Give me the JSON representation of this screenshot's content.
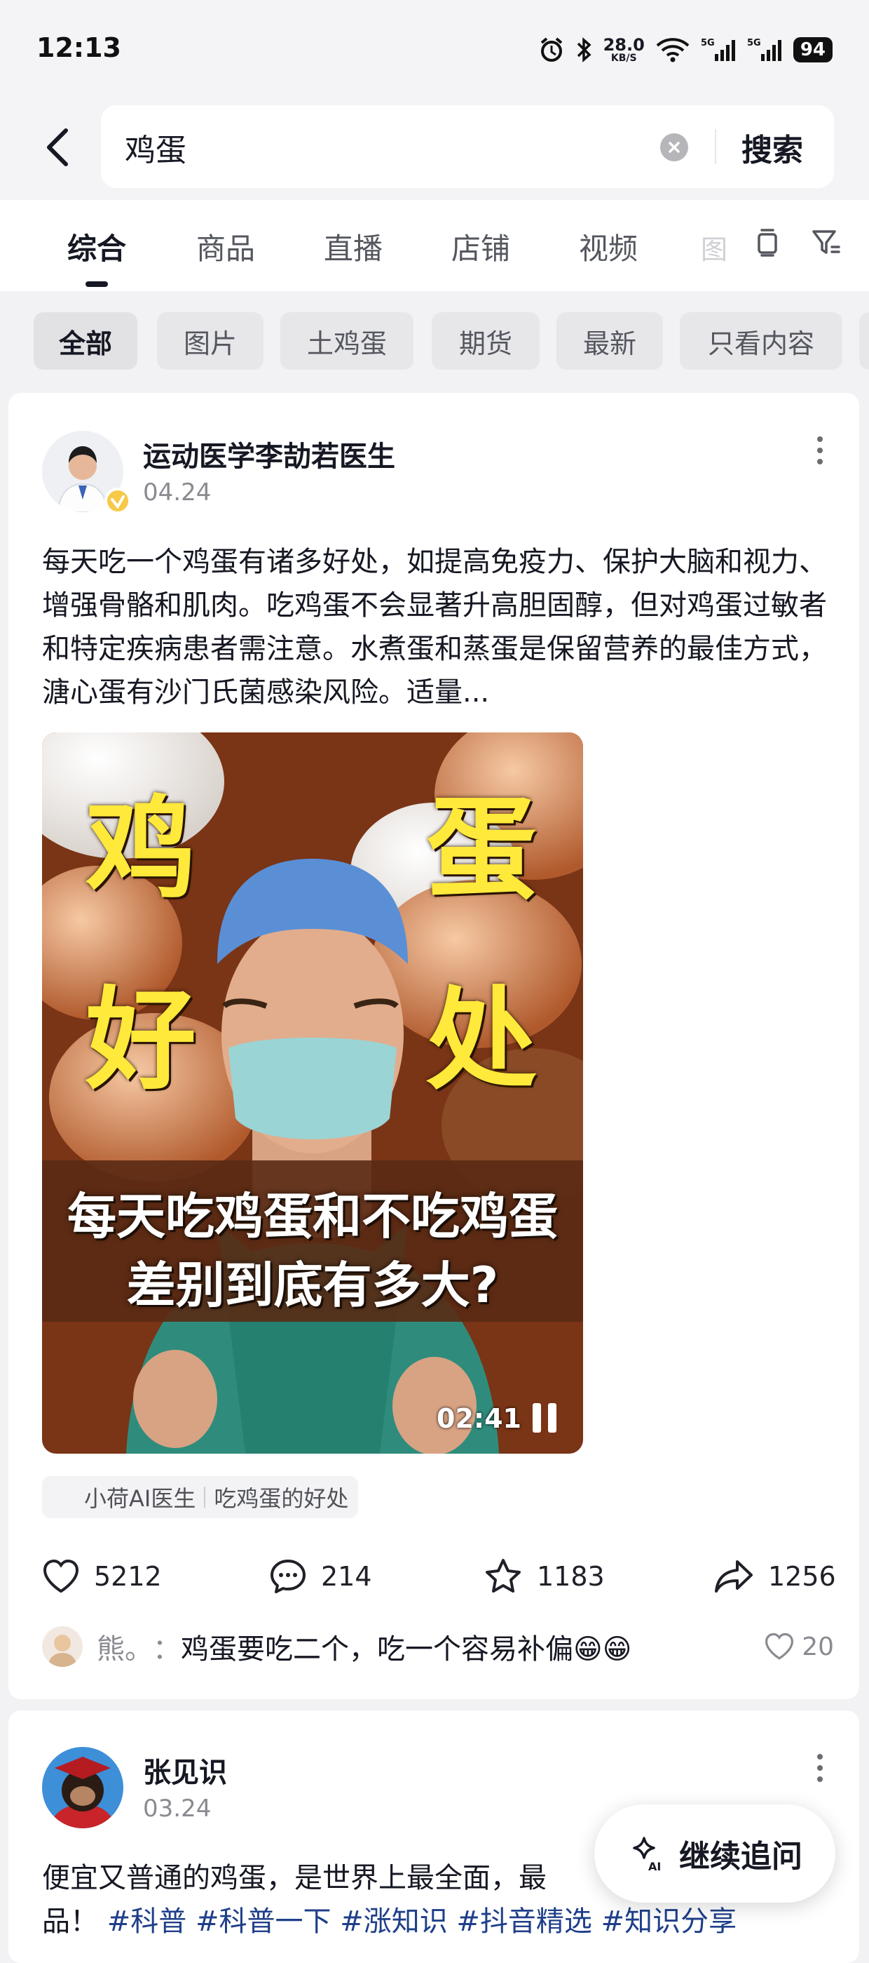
{
  "status_bar": {
    "time": "12:13",
    "net_speed": "28.0",
    "net_unit": "KB/S",
    "battery": "94"
  },
  "search": {
    "query": "鸡蛋",
    "button_label": "搜索"
  },
  "tabs": [
    {
      "label": "综合"
    },
    {
      "label": "商品"
    },
    {
      "label": "直播"
    },
    {
      "label": "店铺"
    },
    {
      "label": "视频"
    },
    {
      "label": "图"
    }
  ],
  "chips": [
    {
      "label": "全部"
    },
    {
      "label": "图片"
    },
    {
      "label": "土鸡蛋"
    },
    {
      "label": "期货"
    },
    {
      "label": "最新"
    },
    {
      "label": "只看内容"
    }
  ],
  "posts": [
    {
      "author": "运动医学李劼若医生",
      "date": "04.24",
      "text": "每天吃一个鸡蛋有诸多好处，如提高免疫力、保护大脑和视力、增强骨骼和肌肉。吃鸡蛋不会显著升高胆固醇，但对鸡蛋过敏者和特定疾病患者需注意。水煮蛋和蒸蛋是保留营养的最佳方式，溏心蛋有沙门氏菌感染风险。适量...",
      "video": {
        "big_chars": [
          "鸡",
          "蛋",
          "好",
          "处"
        ],
        "subtitle_line1": "每天吃鸡蛋和不吃鸡蛋",
        "subtitle_line2": "差别到底有多大?",
        "duration": "02:41"
      },
      "ai_tag": {
        "name": "小荷AI医生",
        "topic": "吃鸡蛋的好处"
      },
      "likes": "5212",
      "comments": "214",
      "favorites": "1183",
      "shares": "1256",
      "top_comment": {
        "user": "熊。",
        "separator": "：",
        "text": "鸡蛋要吃二个，吃一个容易补偏😁😁",
        "likes": "20"
      }
    },
    {
      "author": "张见识",
      "date": "03.24",
      "text_line1": "便宜又普通的鸡蛋，是世界上最全面，最",
      "text_line2_start": "品！",
      "hashtags": [
        "#科普",
        "#科普一下",
        "#涨知识",
        "#抖音精选",
        "#知识分享"
      ]
    }
  ],
  "float_button": {
    "label": "继续追问"
  },
  "colors": {
    "background": "#f2f2f4",
    "hashtag": "#1f3f8a",
    "overlay_yellow": "#ffe93a"
  }
}
